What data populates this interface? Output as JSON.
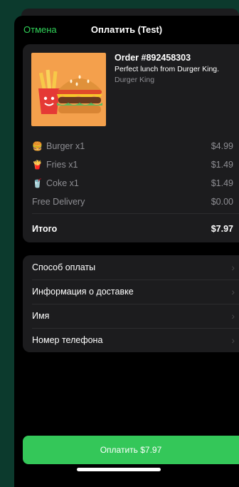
{
  "nav": {
    "cancel_label": "Отмена",
    "title": "Оплатить (Test)"
  },
  "order": {
    "title": "Order #892458303",
    "description": "Perfect lunch from Durger King.",
    "merchant": "Durger King",
    "image_icon": "burger-fries-icon"
  },
  "items": [
    {
      "icon": "🍔",
      "icon_name": "burger-icon",
      "label": "Burger x1",
      "price": "$4.99"
    },
    {
      "icon": "🍟",
      "icon_name": "fries-icon",
      "label": "Fries x1",
      "price": "$1.49"
    },
    {
      "icon": "🥤",
      "icon_name": "cola-icon",
      "label": "Coke x1",
      "price": "$1.49"
    }
  ],
  "delivery": {
    "label": "Free Delivery",
    "price": "$0.00"
  },
  "total": {
    "label": "Итого",
    "price": "$7.97"
  },
  "menu": {
    "payment_method": "Способ оплаты",
    "shipping_info": "Информация о доставке",
    "name": "Имя",
    "phone": "Номер телефона",
    "chevron": "›"
  },
  "pay_button": {
    "label": "Оплатить $7.97"
  },
  "colors": {
    "accent": "#30d158",
    "button": "#34c759",
    "background": "#0c3a2d",
    "card": "#1c1c1e"
  }
}
